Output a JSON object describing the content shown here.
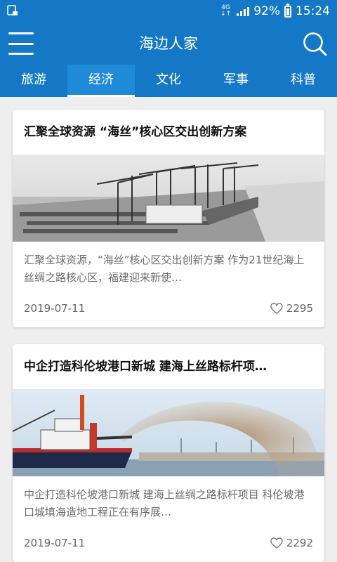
{
  "status_bar": {
    "network_top": "4G",
    "network_bottom": "↓↑",
    "battery": "92%",
    "battery_level": 0.92,
    "time": "15:24"
  },
  "app_bar": {
    "title": "海边人家",
    "menu_icon": "hamburger-menu-icon",
    "search_icon": "search-icon"
  },
  "tabs": [
    {
      "label": "旅游",
      "active": false
    },
    {
      "label": "经济",
      "active": true
    },
    {
      "label": "文化",
      "active": false
    },
    {
      "label": "军事",
      "active": false
    },
    {
      "label": "科普",
      "active": false
    }
  ],
  "articles": [
    {
      "title": "汇聚全球资源 “海丝”核心区交出创新方案",
      "summary": "  汇聚全球资源，“海丝”核心区交出创新方案  作为21世纪海上丝绸之路核心区，福建迎来新使…",
      "date": "2019-07-11",
      "likes": "2295"
    },
    {
      "title": "中企打造科伦坡港口新城 建海上丝路标杆项…",
      "summary": "  中企打造科伦坡港口新城 建海上丝绸之路标杆项目  科伦坡港口城填海造地工程正在有序展…",
      "date": "2019-07-11",
      "likes": "2292"
    }
  ],
  "colors": {
    "primary": "#1478c7",
    "background": "#eeeeee",
    "card": "#ffffff"
  }
}
